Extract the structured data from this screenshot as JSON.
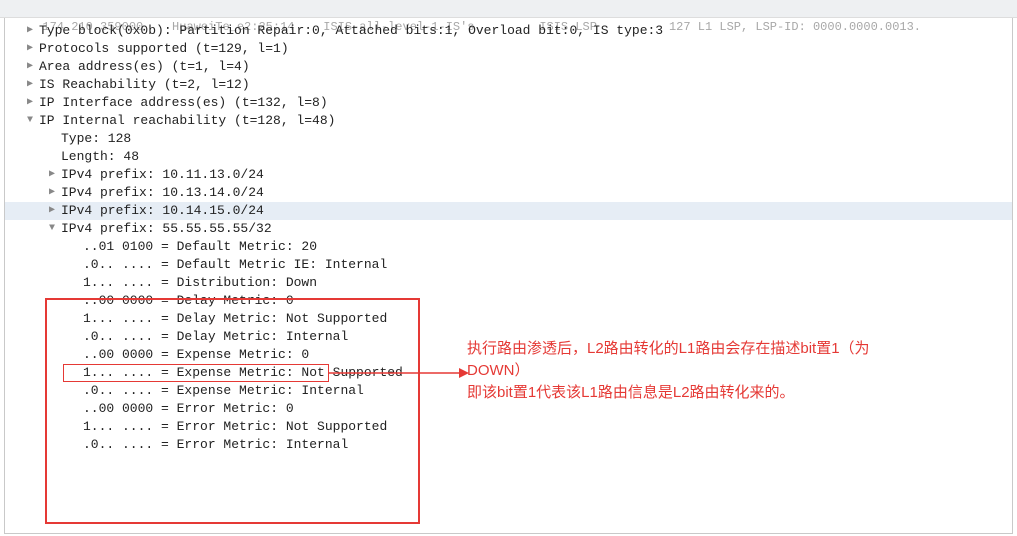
{
  "header": {
    "frame": "174",
    "time": "210.359000",
    "src": "HuaweiTe_e2:25:14",
    "dst": "ISIS-all-level-1-IS's",
    "proto": "ISIS LSP",
    "info": "127 L1 LSP, LSP-ID: 0000.0000.0013."
  },
  "tree": [
    {
      "indent": 0,
      "toggle": ">",
      "text": "Type block(0x0b): Partition Repair:0, Attached bits:1, Overload bit:0, IS type:3"
    },
    {
      "indent": 0,
      "toggle": ">",
      "text": "Protocols supported (t=129, l=1)"
    },
    {
      "indent": 0,
      "toggle": ">",
      "text": "Area address(es) (t=1, l=4)"
    },
    {
      "indent": 0,
      "toggle": ">",
      "text": "IS Reachability (t=2, l=12)"
    },
    {
      "indent": 0,
      "toggle": ">",
      "text": "IP Interface address(es) (t=132, l=8)"
    },
    {
      "indent": 0,
      "toggle": "v",
      "text": "IP Internal reachability (t=128, l=48)"
    },
    {
      "indent": 1,
      "toggle": "",
      "text": "Type: 128"
    },
    {
      "indent": 1,
      "toggle": "",
      "text": "Length: 48"
    },
    {
      "indent": 1,
      "toggle": ">",
      "text": "IPv4 prefix: 10.11.13.0/24"
    },
    {
      "indent": 1,
      "toggle": ">",
      "text": "IPv4 prefix: 10.13.14.0/24"
    },
    {
      "indent": 1,
      "toggle": ">",
      "text": "IPv4 prefix: 10.14.15.0/24",
      "hl": true
    },
    {
      "indent": 1,
      "toggle": "v",
      "text": "IPv4 prefix: 55.55.55.55/32"
    },
    {
      "indent": 2,
      "toggle": "",
      "text": "..01 0100 = Default Metric: 20"
    },
    {
      "indent": 2,
      "toggle": "",
      "text": ".0.. .... = Default Metric IE: Internal"
    },
    {
      "indent": 2,
      "toggle": "",
      "text": "1... .... = Distribution: Down"
    },
    {
      "indent": 2,
      "toggle": "",
      "text": "..00 0000 = Delay Metric: 0"
    },
    {
      "indent": 2,
      "toggle": "",
      "text": "1... .... = Delay Metric: Not Supported"
    },
    {
      "indent": 2,
      "toggle": "",
      "text": ".0.. .... = Delay Metric: Internal"
    },
    {
      "indent": 2,
      "toggle": "",
      "text": "..00 0000 = Expense Metric: 0"
    },
    {
      "indent": 2,
      "toggle": "",
      "text": "1... .... = Expense Metric: Not Supported"
    },
    {
      "indent": 2,
      "toggle": "",
      "text": ".0.. .... = Expense Metric: Internal"
    },
    {
      "indent": 2,
      "toggle": "",
      "text": "..00 0000 = Error Metric: 0"
    },
    {
      "indent": 2,
      "toggle": "",
      "text": "1... .... = Error Metric: Not Supported"
    },
    {
      "indent": 2,
      "toggle": "",
      "text": ".0.. .... = Error Metric: Internal"
    }
  ],
  "annotation": {
    "line1": "执行路由渗透后，L2路由转化的L1路由会存在描述bit置1（为DOWN）",
    "line2": "即该bit置1代表该L1路由信息是L2路由转化来的。"
  }
}
